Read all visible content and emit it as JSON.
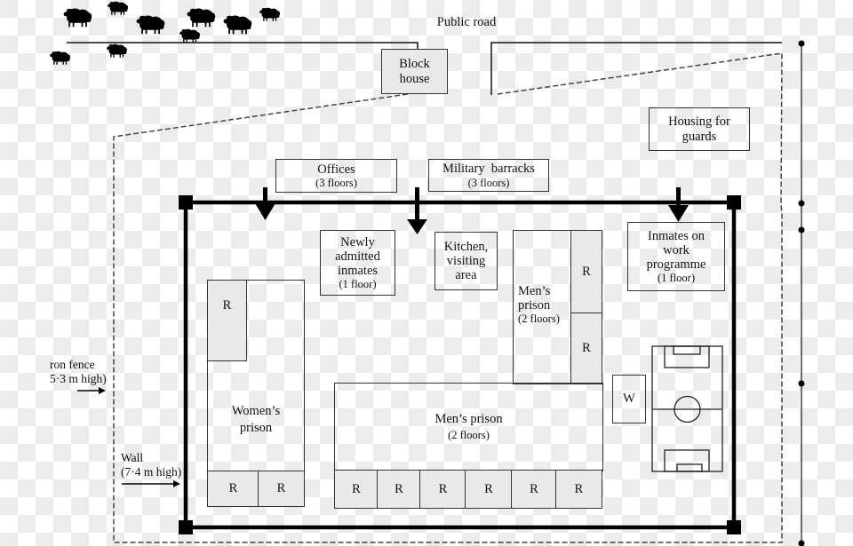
{
  "diagram": {
    "type": "prison site plan",
    "road_label": "Public road",
    "labels": {
      "block_house": [
        "Block",
        "house"
      ],
      "housing_guards": [
        "Housing for",
        "guards"
      ],
      "offices": {
        "name": "Offices",
        "floors": "(3 floors)"
      },
      "barracks": {
        "name": "Military  barracks",
        "floors": "(3 floors)"
      },
      "newly_admitted": {
        "lines": [
          "Newly",
          "admitted",
          "inmates"
        ],
        "floors": "(1 floor)"
      },
      "kitchen": [
        "Kitchen,",
        "visiting",
        "area"
      ],
      "work_programme": {
        "lines": [
          "Inmates on",
          "work",
          "programme"
        ],
        "floors": "(1 floor)"
      },
      "mens_prison_upper": {
        "lines": [
          "Men’s",
          "prison"
        ],
        "floors": "(2 floors)"
      },
      "mens_prison_lower": {
        "name": "Men’s prison",
        "floors": "(2 floors)"
      },
      "womens_prison": [
        "Women’s",
        "prison"
      ],
      "room": "R",
      "washroom": "W",
      "iron_fence": [
        "ron fence",
        "5·3 m high)"
      ],
      "wall": [
        "Wall",
        "(7·4 m high)"
      ]
    },
    "icons": {
      "animal": "sheep-icon",
      "count": 9
    },
    "colors": {
      "line": "#111111",
      "box_border": "#333333",
      "shaded_fill": "#e9e9e9",
      "dashed": "#444444"
    }
  }
}
